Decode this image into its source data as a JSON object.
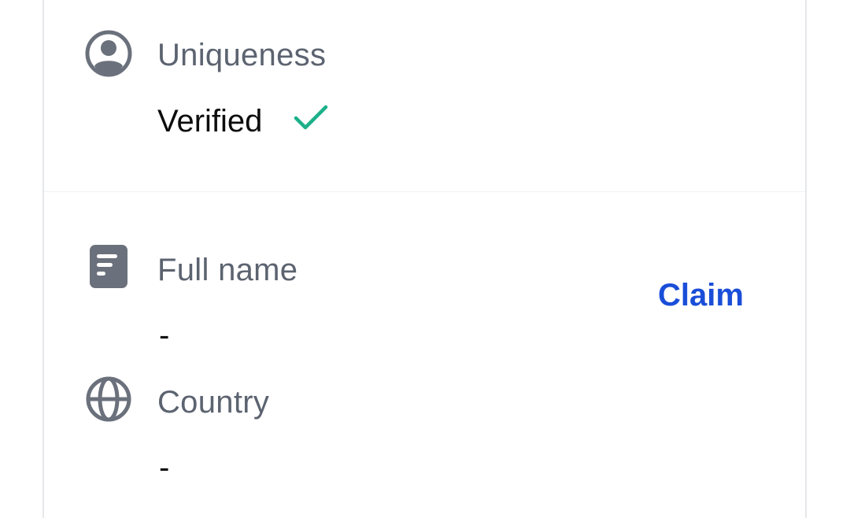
{
  "uniqueness": {
    "label": "Uniqueness",
    "value": "Verified",
    "icon": "user-circle-icon",
    "status_icon": "check-icon",
    "status_color": "#1bb08a"
  },
  "full_name": {
    "label": "Full name",
    "value": "-",
    "icon": "document-icon"
  },
  "country": {
    "label": "Country",
    "value": "-",
    "icon": "globe-icon"
  },
  "claim_action": {
    "label": "Claim",
    "color": "#1a4ed8"
  }
}
